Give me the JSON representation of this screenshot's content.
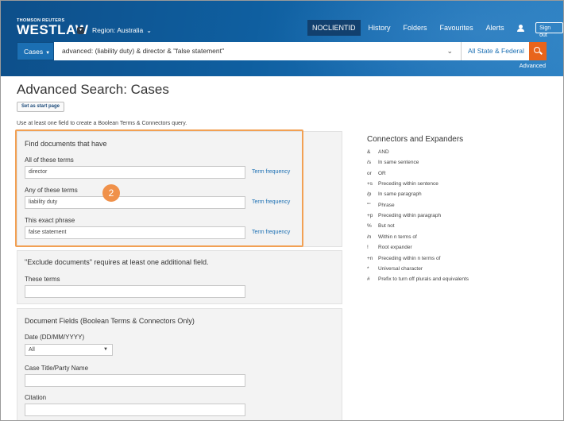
{
  "header": {
    "brand_top": "THOMSON REUTERS",
    "brand": "WESTLAW",
    "region": "Region: Australia",
    "nav": [
      "NOCLIENTID",
      "History",
      "Folders",
      "Favourites",
      "Alerts"
    ],
    "signout": "Sign out",
    "advanced": "Advanced"
  },
  "search": {
    "scope": "Cases",
    "query": "advanced: (liability duty) & director & \"false statement\"",
    "jurisdiction": "All State & Federal"
  },
  "page": {
    "title": "Advanced Search: Cases",
    "start_page": "Set as start page",
    "hint": "Use at least one field to create a Boolean Terms & Connectors query."
  },
  "find": {
    "title": "Find documents that have",
    "all_label": "All of these terms",
    "all_value": "director",
    "any_label": "Any of these terms",
    "any_value": "liability duty",
    "phrase_label": "This exact phrase",
    "phrase_value": "false statement",
    "term_frequency": "Term frequency",
    "badge": "2"
  },
  "exclude": {
    "title": "\"Exclude documents\" requires at least one additional field.",
    "label": "These terms",
    "value": ""
  },
  "fields": {
    "title": "Document Fields (Boolean Terms & Connectors Only)",
    "date_label": "Date (DD/MM/YYYY)",
    "date_value": "All",
    "case_title_label": "Case Title/Party Name",
    "citation_label": "Citation"
  },
  "connectors": {
    "title": "Connectors and Expanders",
    "items": [
      {
        "sym": "&",
        "desc": "AND"
      },
      {
        "sym": "/s",
        "desc": "In same sentence"
      },
      {
        "sym": "or",
        "desc": "OR"
      },
      {
        "sym": "+s",
        "desc": "Preceding within sentence"
      },
      {
        "sym": "/p",
        "desc": "In same paragraph"
      },
      {
        "sym": "\"\"",
        "desc": "Phrase"
      },
      {
        "sym": "+p",
        "desc": "Preceding within paragraph"
      },
      {
        "sym": "%",
        "desc": "But not"
      },
      {
        "sym": "/n",
        "desc": "Within n terms of"
      },
      {
        "sym": "!",
        "desc": "Root expander"
      },
      {
        "sym": "+n",
        "desc": "Preceding within n terms of"
      },
      {
        "sym": "*",
        "desc": "Universal character"
      },
      {
        "sym": "#",
        "desc": "Prefix to turn off plurals and equivalents"
      }
    ]
  },
  "colors": {
    "header": "#0f5fa0",
    "accent": "#e8641b",
    "link": "#1b6fb3",
    "highlight": "#f2a053"
  }
}
